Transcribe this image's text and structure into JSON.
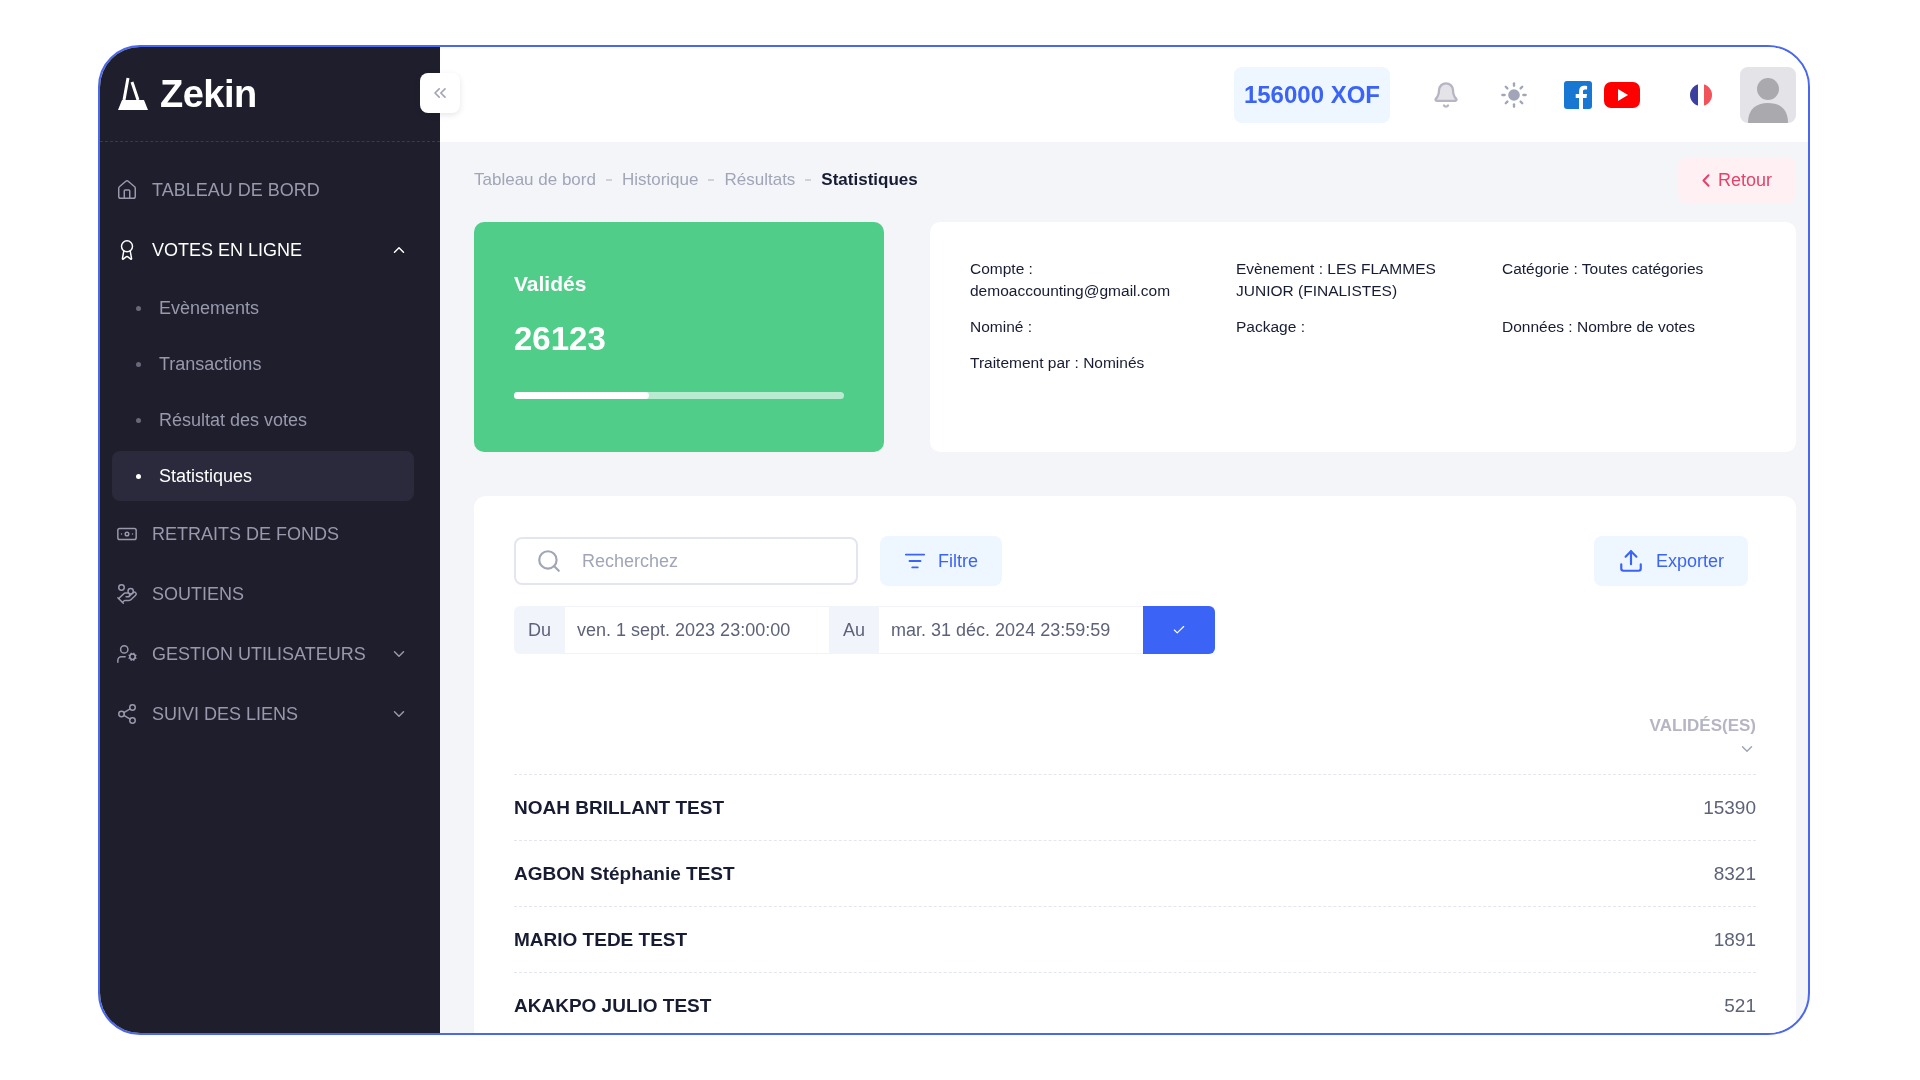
{
  "brand": {
    "name": "Zekin"
  },
  "sidebar": {
    "items": [
      {
        "label": "TABLEAU DE BORD",
        "kind": "link",
        "selected": false
      },
      {
        "label": "VOTES EN LIGNE",
        "kind": "group",
        "selected": true,
        "expanded": true,
        "children": [
          {
            "label": "Evènements",
            "selected": false
          },
          {
            "label": "Transactions",
            "selected": false
          },
          {
            "label": "Résultat des votes",
            "selected": false
          },
          {
            "label": "Statistiques",
            "selected": true
          }
        ]
      },
      {
        "label": "RETRAITS DE FONDS",
        "kind": "link",
        "selected": false
      },
      {
        "label": "SOUTIENS",
        "kind": "link",
        "selected": false
      },
      {
        "label": "GESTION UTILISATEURS",
        "kind": "group",
        "selected": false,
        "expanded": false
      },
      {
        "label": "SUIVI DES LIENS",
        "kind": "group",
        "selected": false,
        "expanded": false
      }
    ]
  },
  "header": {
    "balance": "156000 XOF"
  },
  "breadcrumb": [
    {
      "label": "Tableau de bord",
      "current": false
    },
    {
      "label": "Historique",
      "current": false
    },
    {
      "label": "Résultats",
      "current": false
    },
    {
      "label": "Statistiques",
      "current": true
    }
  ],
  "back_button": "Retour",
  "stat_card": {
    "title": "Validés",
    "value": "26123",
    "level": 0.41
  },
  "info": [
    "Compte : demoaccounting@gmail.com",
    "Evènement : LES FLAMMES JUNIOR (FINALISTES)",
    "Catégorie : Toutes catégories",
    "Nominé :",
    "Package :",
    "Données : Nombre de votes",
    "Traitement par : Nominés"
  ],
  "search": {
    "placeholder": "Recherchez"
  },
  "filter_button": "Filtre",
  "export_button": "Exporter",
  "date_range": {
    "from_label": "Du",
    "from": "ven. 1 sept. 2023 23:00:00",
    "to_label": "Au",
    "to": "mar. 31 déc. 2024 23:59:59"
  },
  "table": {
    "value_column": "VALIDÉS(ES)",
    "rows": [
      {
        "name": "NOAH BRILLANT TEST",
        "value": "15390"
      },
      {
        "name": "AGBON Stéphanie TEST",
        "value": "8321"
      },
      {
        "name": "MARIO TEDE TEST",
        "value": "1891"
      },
      {
        "name": "AKAKPO JULIO TEST",
        "value": "521"
      }
    ]
  }
}
